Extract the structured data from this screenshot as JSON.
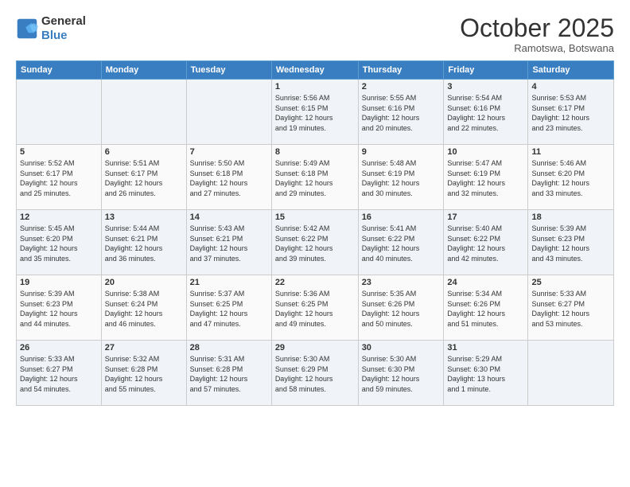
{
  "logo": {
    "line1": "General",
    "line2": "Blue"
  },
  "title": "October 2025",
  "location": "Ramotswa, Botswana",
  "weekdays": [
    "Sunday",
    "Monday",
    "Tuesday",
    "Wednesday",
    "Thursday",
    "Friday",
    "Saturday"
  ],
  "weeks": [
    [
      {
        "day": "",
        "info": ""
      },
      {
        "day": "",
        "info": ""
      },
      {
        "day": "",
        "info": ""
      },
      {
        "day": "1",
        "info": "Sunrise: 5:56 AM\nSunset: 6:15 PM\nDaylight: 12 hours\nand 19 minutes."
      },
      {
        "day": "2",
        "info": "Sunrise: 5:55 AM\nSunset: 6:16 PM\nDaylight: 12 hours\nand 20 minutes."
      },
      {
        "day": "3",
        "info": "Sunrise: 5:54 AM\nSunset: 6:16 PM\nDaylight: 12 hours\nand 22 minutes."
      },
      {
        "day": "4",
        "info": "Sunrise: 5:53 AM\nSunset: 6:17 PM\nDaylight: 12 hours\nand 23 minutes."
      }
    ],
    [
      {
        "day": "5",
        "info": "Sunrise: 5:52 AM\nSunset: 6:17 PM\nDaylight: 12 hours\nand 25 minutes."
      },
      {
        "day": "6",
        "info": "Sunrise: 5:51 AM\nSunset: 6:17 PM\nDaylight: 12 hours\nand 26 minutes."
      },
      {
        "day": "7",
        "info": "Sunrise: 5:50 AM\nSunset: 6:18 PM\nDaylight: 12 hours\nand 27 minutes."
      },
      {
        "day": "8",
        "info": "Sunrise: 5:49 AM\nSunset: 6:18 PM\nDaylight: 12 hours\nand 29 minutes."
      },
      {
        "day": "9",
        "info": "Sunrise: 5:48 AM\nSunset: 6:19 PM\nDaylight: 12 hours\nand 30 minutes."
      },
      {
        "day": "10",
        "info": "Sunrise: 5:47 AM\nSunset: 6:19 PM\nDaylight: 12 hours\nand 32 minutes."
      },
      {
        "day": "11",
        "info": "Sunrise: 5:46 AM\nSunset: 6:20 PM\nDaylight: 12 hours\nand 33 minutes."
      }
    ],
    [
      {
        "day": "12",
        "info": "Sunrise: 5:45 AM\nSunset: 6:20 PM\nDaylight: 12 hours\nand 35 minutes."
      },
      {
        "day": "13",
        "info": "Sunrise: 5:44 AM\nSunset: 6:21 PM\nDaylight: 12 hours\nand 36 minutes."
      },
      {
        "day": "14",
        "info": "Sunrise: 5:43 AM\nSunset: 6:21 PM\nDaylight: 12 hours\nand 37 minutes."
      },
      {
        "day": "15",
        "info": "Sunrise: 5:42 AM\nSunset: 6:22 PM\nDaylight: 12 hours\nand 39 minutes."
      },
      {
        "day": "16",
        "info": "Sunrise: 5:41 AM\nSunset: 6:22 PM\nDaylight: 12 hours\nand 40 minutes."
      },
      {
        "day": "17",
        "info": "Sunrise: 5:40 AM\nSunset: 6:22 PM\nDaylight: 12 hours\nand 42 minutes."
      },
      {
        "day": "18",
        "info": "Sunrise: 5:39 AM\nSunset: 6:23 PM\nDaylight: 12 hours\nand 43 minutes."
      }
    ],
    [
      {
        "day": "19",
        "info": "Sunrise: 5:39 AM\nSunset: 6:23 PM\nDaylight: 12 hours\nand 44 minutes."
      },
      {
        "day": "20",
        "info": "Sunrise: 5:38 AM\nSunset: 6:24 PM\nDaylight: 12 hours\nand 46 minutes."
      },
      {
        "day": "21",
        "info": "Sunrise: 5:37 AM\nSunset: 6:25 PM\nDaylight: 12 hours\nand 47 minutes."
      },
      {
        "day": "22",
        "info": "Sunrise: 5:36 AM\nSunset: 6:25 PM\nDaylight: 12 hours\nand 49 minutes."
      },
      {
        "day": "23",
        "info": "Sunrise: 5:35 AM\nSunset: 6:26 PM\nDaylight: 12 hours\nand 50 minutes."
      },
      {
        "day": "24",
        "info": "Sunrise: 5:34 AM\nSunset: 6:26 PM\nDaylight: 12 hours\nand 51 minutes."
      },
      {
        "day": "25",
        "info": "Sunrise: 5:33 AM\nSunset: 6:27 PM\nDaylight: 12 hours\nand 53 minutes."
      }
    ],
    [
      {
        "day": "26",
        "info": "Sunrise: 5:33 AM\nSunset: 6:27 PM\nDaylight: 12 hours\nand 54 minutes."
      },
      {
        "day": "27",
        "info": "Sunrise: 5:32 AM\nSunset: 6:28 PM\nDaylight: 12 hours\nand 55 minutes."
      },
      {
        "day": "28",
        "info": "Sunrise: 5:31 AM\nSunset: 6:28 PM\nDaylight: 12 hours\nand 57 minutes."
      },
      {
        "day": "29",
        "info": "Sunrise: 5:30 AM\nSunset: 6:29 PM\nDaylight: 12 hours\nand 58 minutes."
      },
      {
        "day": "30",
        "info": "Sunrise: 5:30 AM\nSunset: 6:30 PM\nDaylight: 12 hours\nand 59 minutes."
      },
      {
        "day": "31",
        "info": "Sunrise: 5:29 AM\nSunset: 6:30 PM\nDaylight: 13 hours\nand 1 minute."
      },
      {
        "day": "",
        "info": ""
      }
    ]
  ]
}
